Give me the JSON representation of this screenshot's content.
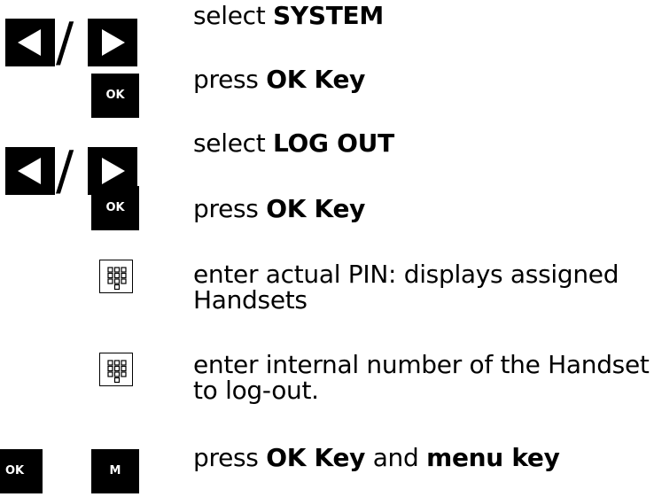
{
  "steps": [
    {
      "icon": "left-right-arrows",
      "prefix": "select ",
      "bold": "SYSTEM",
      "suffix": ""
    },
    {
      "icon": "ok-key",
      "key_label": "OK",
      "prefix": "press ",
      "bold": "OK Key",
      "suffix": ""
    },
    {
      "icon": "left-right-arrows",
      "prefix": "select ",
      "bold": "LOG OUT",
      "suffix": ""
    },
    {
      "icon": "ok-key",
      "key_label": "OK",
      "prefix": "press ",
      "bold": "OK Key",
      "suffix": ""
    },
    {
      "icon": "keypad",
      "line1": "enter actual PIN: displays assigned",
      "line2": "Handsets"
    },
    {
      "icon": "keypad",
      "line1": "enter internal number of the Handset",
      "line2": "to log-out."
    },
    {
      "icon": "ok-and-menu-keys",
      "key_label_ok": "OK",
      "key_label_menu": "M",
      "prefix": "press ",
      "bold": "OK Key",
      "middle": " and ",
      "bold2": "menu key"
    }
  ],
  "slash_glyph": "/"
}
